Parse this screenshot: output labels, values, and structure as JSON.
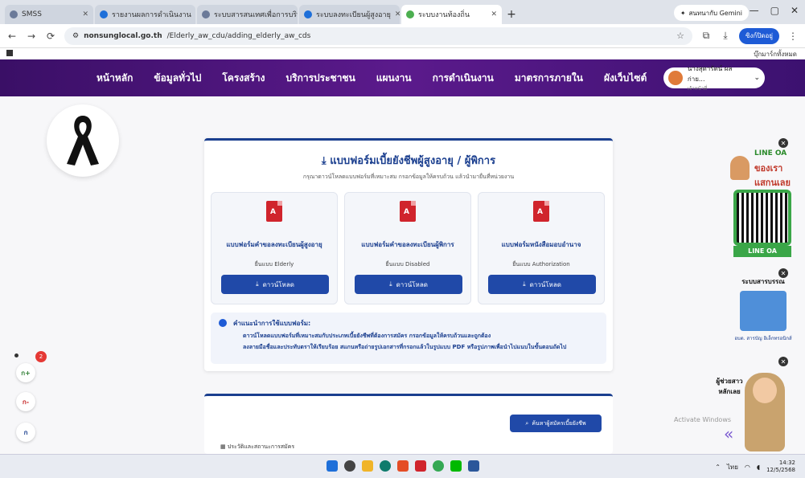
{
  "browser": {
    "tabs": [
      {
        "label": "SMSS",
        "active": false
      },
      {
        "label": "รายงานผลการดำเนินงาน",
        "active": false
      },
      {
        "label": "ระบบสารสนเทศเพื่อการบริหาร",
        "active": false
      },
      {
        "label": "ระบบลงทะเบียนผู้สูงอายุ",
        "active": false
      },
      {
        "label": "ระบบงานท้องถิ่น",
        "active": true
      }
    ],
    "gemini_label": "สนทนากับ Gemini",
    "url_domain": "nonsunglocal.go.th",
    "url_path": "/Elderly_aw_cdu/adding_elderly_aw_cds",
    "profile_label": "ซิงก์ปิดอยู่",
    "bookmarks_label": "บุ๊กมาร์กทั้งหมด"
  },
  "site": {
    "nav": [
      "หน้าหลัก",
      "ข้อมูลทั่วไป",
      "โครงสร้าง",
      "บริการประชาชน",
      "แผนงาน",
      "การดำเนินงาน",
      "มาตรการภายใน",
      "ผังเว็บไซต์"
    ],
    "user": {
      "name": "นางสุดารัตน์ ผลก่าย...",
      "role": "เจ้าหน้าที่"
    }
  },
  "form_card": {
    "title": "แบบฟอร์มเบี้ยยังชีพผู้สูงอายุ / ผู้พิการ",
    "subtitle": "กรุณาดาวน์โหลดแบบฟอร์มที่เหมาะสม กรอกข้อมูลให้ครบถ้วน แล้วนำมายื่นที่หน่วยงาน",
    "downloads": [
      {
        "name": "แบบฟอร์มคำขอลงทะเบียนผู้สูงอายุ",
        "en": "ยื่นแบบ Elderly",
        "button": "ดาวน์โหลด"
      },
      {
        "name": "แบบฟอร์มคำขอลงทะเบียนผู้พิการ",
        "en": "ยื่นแบบ Disabled",
        "button": "ดาวน์โหลด"
      },
      {
        "name": "แบบฟอร์มหนังสือมอบอำนาจ",
        "en": "ยื่นแบบ Authorization",
        "button": "ดาวน์โหลด"
      }
    ],
    "info": {
      "heading": "คำแนะนำการใช้แบบฟอร์ม:",
      "line1": "ดาวน์โหลดแบบฟอร์มที่เหมาะสมกับประเภทเบี้ยยังชีพที่ต้องการสมัคร กรอกข้อมูลให้ครบถ้วนและถูกต้อง",
      "line2": "ลงลายมือชื่อและประทับตราให้เรียบร้อย สแกนหรือถ่ายรูปเอกสารที่กรอกแล้วในรูปแบบ PDF หรือรูปภาพเพื่อนำไปแนบในขั้นตอนถัดไป"
    }
  },
  "card2": {
    "search_button": "ค้นหาผู้สมัครเบี้ยยังชีพ",
    "peek_label": "ประวัติและสถานะการสมัคร"
  },
  "widgets": {
    "line_oa": {
      "t1": "LINE OA",
      "t2": "ของเรา",
      "t3": "แสกนเลย",
      "bar": "LINE OA"
    },
    "saraban": {
      "title": "ระบบสารบรรณ",
      "caption": "อบต. สารบัญ อิเล็กทรอนิกส์"
    },
    "assistant": {
      "title": "ผู้ช่วยสาว หลักเลย"
    },
    "activate": "Activate Windows"
  },
  "left_controls": {
    "plus": "ก+",
    "minus": "ก-",
    "reset": "ก",
    "badge": "2"
  },
  "taskbar": {
    "time": "14:32",
    "date": "12/5/2568",
    "lang": "ไทย"
  },
  "colors": {
    "nav_purple": "#5b1a8c",
    "primary_blue": "#2049a8",
    "pdf_red": "#d0242c",
    "line_green": "#3aa648"
  }
}
